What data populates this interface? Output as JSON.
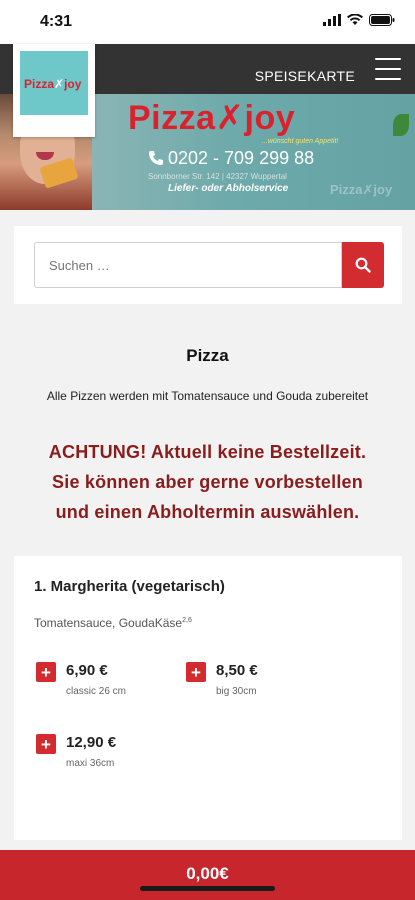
{
  "status_bar": {
    "time": "4:31"
  },
  "nav": {
    "menu_label": "SPEISEKARTE"
  },
  "logo": {
    "brand_left": "Pizza",
    "brand_right": "joy"
  },
  "banner": {
    "brand": "Pizza✗joy",
    "tagline": "...wünscht guten Appetit!",
    "phone": "0202 - 709 299 88",
    "address": "Sonnborner Str. 142 | 42327 Wuppertal",
    "service": "Liefer- oder Abholservice",
    "watermark": "Pizza✗joy"
  },
  "search": {
    "placeholder": "Suchen …"
  },
  "category": {
    "title": "Pizza",
    "description": "Alle Pizzen werden mit Tomatensauce und Gouda zubereitet"
  },
  "notice": {
    "line1": "ACHTUNG! Aktuell keine Bestellzeit.",
    "line2": "Sie können aber gerne vorbestellen",
    "line3": "und einen Abholtermin auswählen."
  },
  "product": {
    "name": "1. Margherita (vegetarisch)",
    "ingredients": "Tomatensauce, GoudaKäse",
    "ingredients_note": "2,6",
    "options": [
      {
        "price": "6,90 €",
        "size": "classic 26 cm"
      },
      {
        "price": "8,50 €",
        "size": "big 30cm"
      },
      {
        "price": "12,90 €",
        "size": "maxi 36cm"
      }
    ]
  },
  "cart": {
    "total": "0,00€"
  },
  "colors": {
    "accent": "#d22c30",
    "notice": "#8a1c1c",
    "navbar": "#333333",
    "banner": "#6eaaab"
  }
}
